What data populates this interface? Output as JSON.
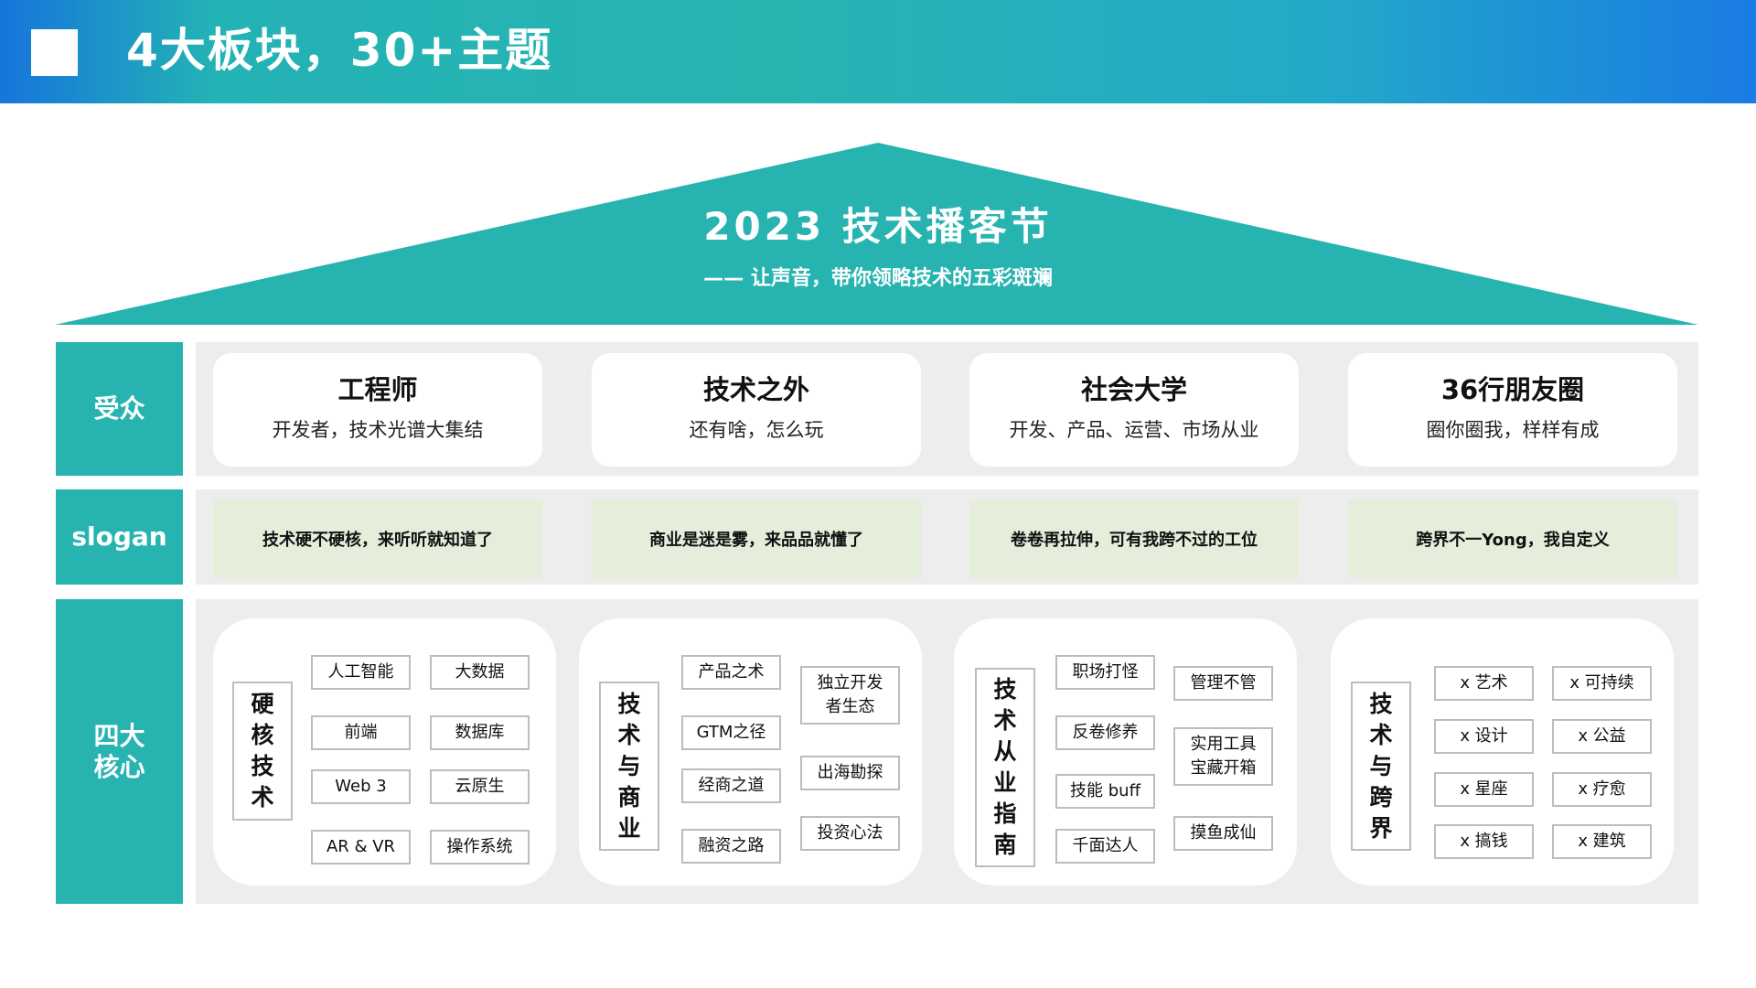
{
  "header": {
    "title": "4大板块，30+主题"
  },
  "roof": {
    "title": "2023 技术播客节",
    "subtitle": "—— 让声音，带你领略技术的五彩斑斓"
  },
  "labels": {
    "audience": "受众",
    "slogan": "slogan",
    "core": "四大核心"
  },
  "audiences": [
    {
      "title": "工程师",
      "desc": "开发者，技术光谱大集结"
    },
    {
      "title": "技术之外",
      "desc": "还有啥，怎么玩"
    },
    {
      "title": "社会大学",
      "desc": "开发、产品、运营、市场从业"
    },
    {
      "title": "36行朋友圈",
      "desc": "圈你圈我，样样有成"
    }
  ],
  "slogans": [
    "技术硬不硬核，来听听就知道了",
    "商业是迷是雾，来品品就懂了",
    "卷卷再拉伸，可有我跨不过的工位",
    "跨界不一Yong，我自定义"
  ],
  "cores": [
    {
      "label": [
        "硬",
        "核",
        "技",
        "术"
      ],
      "tags": [
        "人工智能",
        "大数据",
        "前端",
        "数据库",
        "Web 3",
        "云原生",
        "AR & VR",
        "操作系统"
      ]
    },
    {
      "label": [
        "技",
        "术",
        "与",
        "商",
        "业"
      ],
      "tags": [
        "产品之术",
        "独立开发\n者生态",
        "GTM之径",
        "经商之道",
        "出海勘探",
        "融资之路",
        "投资心法"
      ]
    },
    {
      "label": [
        "技",
        "术",
        "从",
        "业",
        "指",
        "南"
      ],
      "tags": [
        "职场打怪",
        "管理不管",
        "反卷修养",
        "实用工具\n宝藏开箱",
        "技能 buff",
        "千面达人",
        "摸鱼成仙"
      ]
    },
    {
      "label": [
        "技",
        "术",
        "与",
        "跨",
        "界"
      ],
      "tags": [
        "x 艺术",
        "x 可持续",
        "x 设计",
        "x 公益",
        "x 星座",
        "x 疗愈",
        "x 搞钱",
        "x 建筑"
      ]
    }
  ],
  "colors": {
    "teal": "#27b4b1",
    "panel_gray": "#ededed",
    "slogan_green": "#e4eedb",
    "banner_blue": "#1675dc"
  }
}
